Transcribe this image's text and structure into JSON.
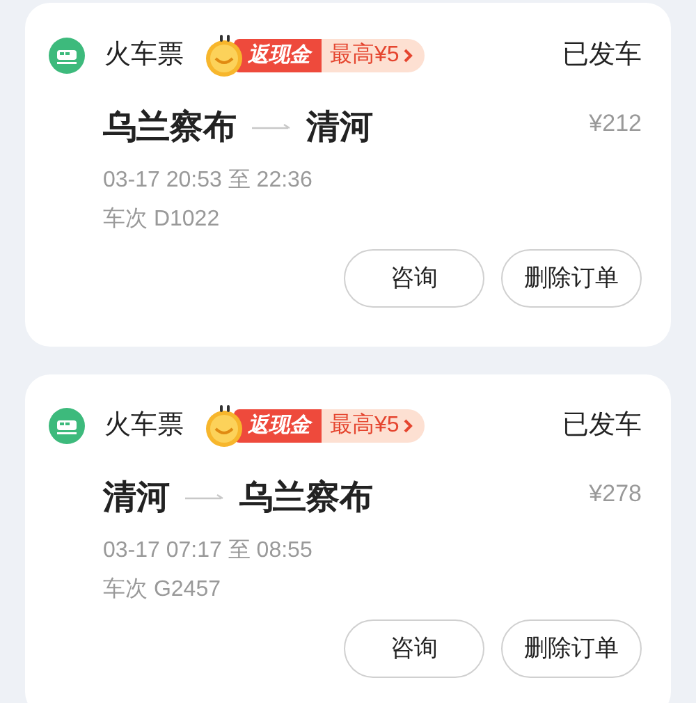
{
  "orders": [
    {
      "category": "火车票",
      "badge": {
        "label": "返现金",
        "offer": "最高¥5"
      },
      "status": "已发车",
      "from": "乌兰察布",
      "to": "清河",
      "price": "¥212",
      "time": "03-17 20:53 至 22:36",
      "train": "车次 D1022",
      "actions": [
        "咨询",
        "删除订单"
      ]
    },
    {
      "category": "火车票",
      "badge": {
        "label": "返现金",
        "offer": "最高¥5"
      },
      "status": "已发车",
      "from": "清河",
      "to": "乌兰察布",
      "price": "¥278",
      "time": "03-17 07:17 至 08:55",
      "train": "车次 G2457",
      "actions": [
        "咨询",
        "删除订单"
      ]
    }
  ]
}
